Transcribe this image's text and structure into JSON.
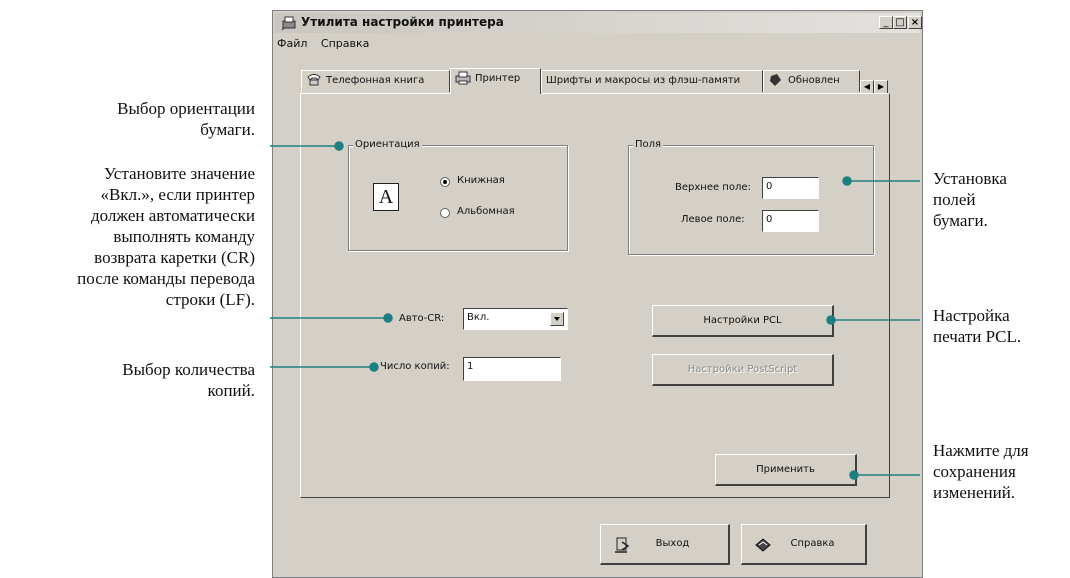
{
  "window": {
    "title": "Утилита настройки принтера",
    "min_glyph": "_",
    "max_glyph": "□",
    "close_glyph": "×"
  },
  "menu": {
    "file": "Файл",
    "help": "Справка"
  },
  "tabs": [
    {
      "label": "Телефонная книга",
      "icon": "phonebook-icon"
    },
    {
      "label": "Принтер",
      "icon": "printer-icon",
      "active": true
    },
    {
      "label": "Шрифты и макросы из флэш-памяти"
    },
    {
      "label": "Обновлен",
      "icon": "update-icon"
    }
  ],
  "orientation": {
    "group_label": "Ориентация",
    "portrait": "Книжная",
    "landscape": "Альбомная",
    "selected": "portrait",
    "page_letter": "A"
  },
  "margins": {
    "group_label": "Поля",
    "top_label": "Верхнее поле:",
    "top_value": "0",
    "left_label": "Левое поле:",
    "left_value": "0"
  },
  "auto_cr": {
    "label": "Авто-CR:",
    "value": "Вкл."
  },
  "copies": {
    "label": "Число копий:",
    "value": "1"
  },
  "buttons": {
    "pcl": "Настройки PCL",
    "postscript": "Настройки PostScript",
    "apply": "Применить",
    "exit": "Выход",
    "help": "Справка"
  },
  "callouts": {
    "orientation": [
      "Выбор ориентации",
      "бумаги."
    ],
    "autocr": [
      "Установите значение",
      "«Вкл.», если принтер",
      "должен автоматически",
      "выполнять команду",
      "возврата каретки (CR)",
      "после команды перевода",
      "строки (LF)."
    ],
    "copies": [
      "Выбор количества",
      "копий."
    ],
    "margins": [
      "Установка",
      "полей",
      "бумаги."
    ],
    "pcl": [
      "Настройка",
      "печати PCL."
    ],
    "apply": [
      "Нажмите для",
      "сохранения",
      "изменений."
    ]
  },
  "colors": {
    "callout_line": "#1e7f80",
    "window_bg": "#d4d0c8"
  }
}
